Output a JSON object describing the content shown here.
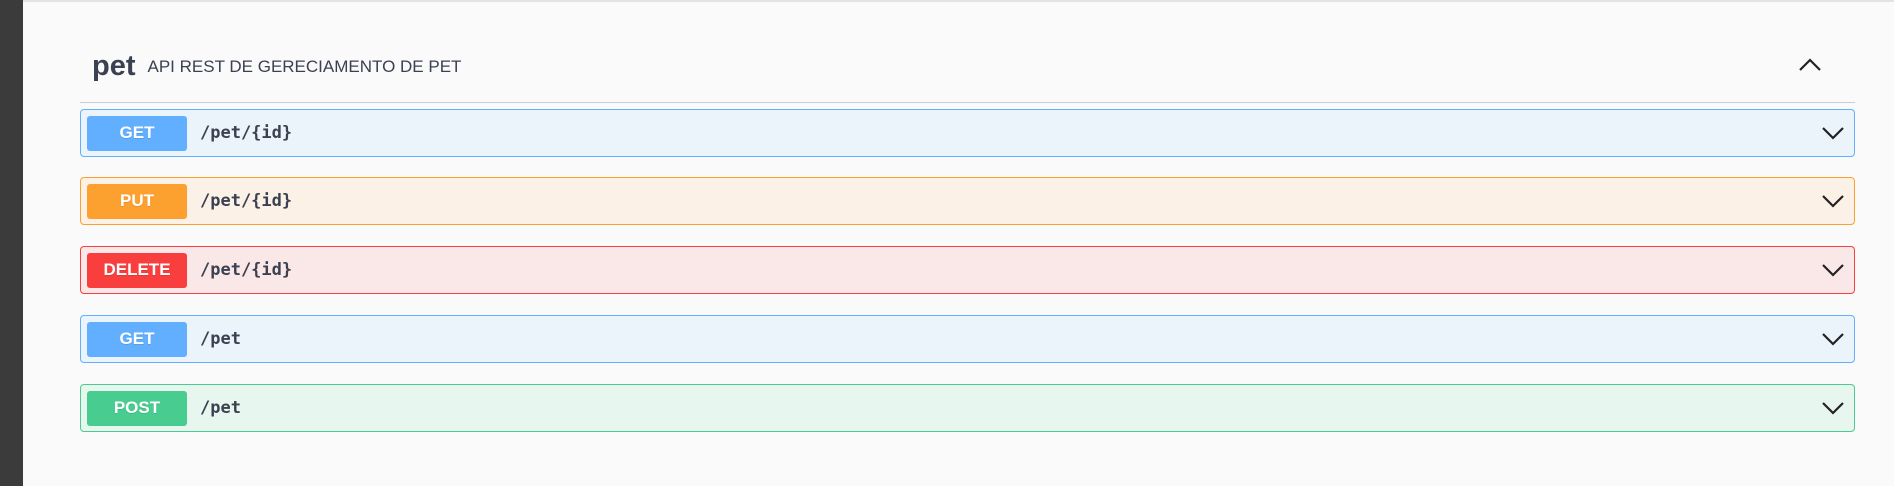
{
  "tag": {
    "name": "pet",
    "description": "API REST DE GERECIAMENTO DE PET",
    "collapse_icon": "chevron-up-icon"
  },
  "operations": [
    {
      "method": "GET",
      "path": "/pet/{id}",
      "color": "#61affe",
      "icon": "chevron-down-icon"
    },
    {
      "method": "PUT",
      "path": "/pet/{id}",
      "color": "#fca130",
      "icon": "chevron-down-icon"
    },
    {
      "method": "DELETE",
      "path": "/pet/{id}",
      "color": "#f93e3e",
      "icon": "chevron-down-icon"
    },
    {
      "method": "GET",
      "path": "/pet",
      "color": "#61affe",
      "icon": "chevron-down-icon"
    },
    {
      "method": "POST",
      "path": "/pet",
      "color": "#49cc90",
      "icon": "chevron-down-icon"
    }
  ]
}
